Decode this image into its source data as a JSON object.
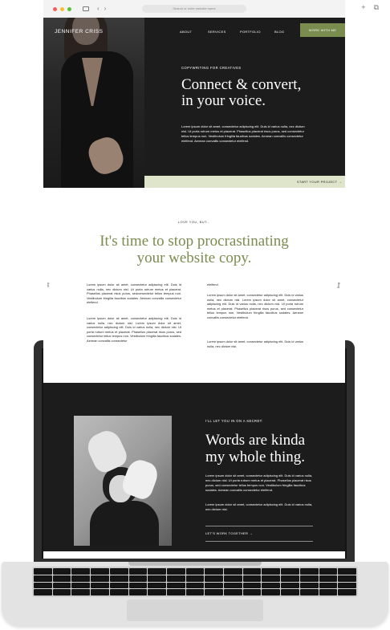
{
  "browser": {
    "address": "Search or enter website name"
  },
  "header": {
    "brand": "JENNIFER CRISS",
    "nav": [
      "ABOUT",
      "SERVICES",
      "PORTFOLIO",
      "BLOG"
    ],
    "cta": "WORK WITH ME"
  },
  "hero": {
    "eyebrow": "COPYWRITING FOR CREATIVES",
    "title_line1": "Connect & convert,",
    "title_line2": "in your voice.",
    "body": "Lorem ipsum dolor sit amet, consectetur adipiscing elit. Duis id varius nulla, nec dictum nisl. Ut porta rutrum metus et placerat. Phasellus placerat risus purus, sed consectetur tellus tempus non. Vestibulum fringilla faucibus sodales. Aenean convallis consectetur eleifend. Aenean convallis consectetur eleifend.",
    "link": "START YOUR PROJECT →"
  },
  "intro": {
    "eyebrow": "LOVE YOU, BUT...",
    "title_line1": "It's time to stop procrastinating",
    "title_line2": "your website copy.",
    "side_left": "Ask",
    "side_right": "Blog",
    "col1_p1": "Lorem ipsum dolor sit amet, consectetur adipiscing elit. Duis id varius nulla, nec dictum nisl. Ut porta rutrum metus et placerat. Phasellus placerat risus purus, sedconsectetur tellus tempus non. Vestibulum fringilla faucibus sodales. Aenean convallis consectetur eleifend.",
    "col1_p2": "Lorem ipsum dolor sit amet, consectetur adipiscing elit. Duis id varius nulla, nec dictum nisl. Lorem ipsum dolor sit amet, consectetur adipiscing elit. Duis id varius nulla, nec dictum nisl. Ut porta rutrum metus et placerat. Phasellus placerat risus purus, sed consectetur tellus tempus non. Vestibulum fringilla faucibus sodales. Aenean convallis consectetur",
    "col2_top": "eleifend.",
    "col2_p1": "Lorem ipsum dolor sit amet, consectetur adipiscing elit. Duis id varius nulla, nec dictum nisl. Lorem ipsum dolor sit amet, consectetur adipiscing elit. Duis id varius nulla, nec dictum nisl. Ut porta rutrum metus et placerat. Phasellus placerat risus purus, sed consectetur tellus tempus non. Vestibulum fringilla faucibus sodales. Aenean convallis consectetur eleifend.",
    "col2_p2": "Lorem ipsum dolor sit amet, consectetur adipiscing elit. Duis id varius nulla, nec dictum nisl."
  },
  "secret": {
    "eyebrow": "I'LL LET YOU IN ON A SECRET:",
    "title_line1": "Words are kinda",
    "title_line2": "my whole thing.",
    "body1": "Lorem ipsum dolor sit amet, consectetur adipiscing elit. Duis id varius nulla, nec dictum nisl. Ut porta rutrum metus et placerat. Phasellus placerat risus purus, sed consectetur tellus tempus non. Vestibulum fringilla faucibus sodales. Aenean convallis consectetur eleifend.",
    "body2": "Lorem ipsum dolor sit amet, consectetur adipiscing elit. Duis id varius nulla, nec dictum nisl.",
    "link": "LET'S WORK TOGETHER →"
  },
  "colors": {
    "accent_green": "#7b8c4f",
    "strip_green": "#dfe5cb",
    "dark_bg": "#1c1c1c"
  }
}
